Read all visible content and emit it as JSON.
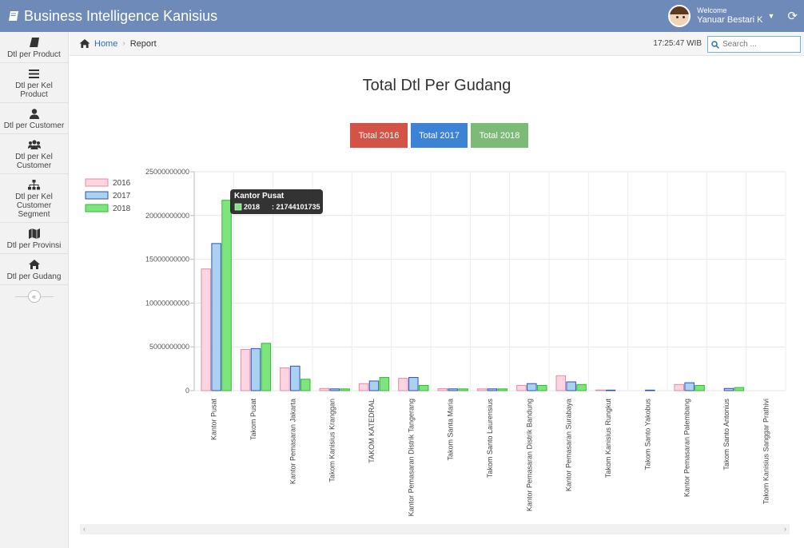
{
  "app": {
    "title": "Business Intelligence Kanisius"
  },
  "user": {
    "welcome": "Welcome",
    "name": "Yanuar Bestari K"
  },
  "sidebar": {
    "items": [
      {
        "label": "Dtl per Product",
        "icon": "book-icon"
      },
      {
        "label": "Dtl per Kel Product",
        "icon": "list-icon"
      },
      {
        "label": "Dtl per Customer",
        "icon": "user-icon"
      },
      {
        "label": "Dtl per Kel Customer",
        "icon": "users-icon"
      },
      {
        "label": "Dtl per Kel Customer Segment",
        "icon": "sitemap-icon"
      },
      {
        "label": "Dtl per Provinsi",
        "icon": "map-icon"
      },
      {
        "label": "Dtl per Gudang",
        "icon": "home-icon"
      }
    ],
    "collapse": "«"
  },
  "breadcrumb": {
    "home": "Home",
    "current": "Report"
  },
  "clock": "17:25:47 WIB",
  "search": {
    "placeholder": "Search ..."
  },
  "page": {
    "title": "Total Dtl Per Gudang",
    "buttons": [
      {
        "label": "Total 2016",
        "color": "#d35446"
      },
      {
        "label": "Total 2017",
        "color": "#3d83d5"
      },
      {
        "label": "Total 2018",
        "color": "#7cba78"
      }
    ]
  },
  "tooltip": {
    "title": "Kantor Pusat",
    "series": "2018",
    "value": ": 21744101735"
  },
  "chart_data": {
    "type": "bar",
    "title": "",
    "ylim": [
      0,
      25000000000
    ],
    "yticks": [
      0,
      5000000000,
      10000000000,
      15000000000,
      20000000000,
      25000000000
    ],
    "grid": true,
    "legend": "left",
    "categories": [
      "Kantor Pusat",
      "Takom Pusat",
      "Kantor Pemasaran Jakarta",
      "Takom Kanisius Kranggan",
      "TAKOM KATEDRAL",
      "Kantor Pemasaran Distrik Tangerang",
      "Takom Santa Maria",
      "Takom Santo Laurensius",
      "Kantor Pemasaran Distrik Bandung",
      "Kantor Pemasaran Surabaya",
      "Takom Kanisius Rungkut",
      "Takom Santo Yakobus",
      "Kantor Pemasaran Palembang",
      "Takom Santo Antonius",
      "Takom Kanisius Sanggar Prathivi"
    ],
    "series": [
      {
        "name": "2016",
        "fill": "#fcd5e0",
        "stroke": "#e58aa5",
        "values": [
          13900000000,
          4700000000,
          2600000000,
          250000000,
          800000000,
          1400000000,
          220000000,
          200000000,
          600000000,
          1700000000,
          70000000,
          0,
          700000000,
          0,
          0
        ]
      },
      {
        "name": "2017",
        "fill": "#a9d2f2",
        "stroke": "#2f4fb3",
        "values": [
          16800000000,
          4800000000,
          2800000000,
          200000000,
          1100000000,
          1500000000,
          200000000,
          200000000,
          800000000,
          1000000000,
          60000000,
          60000000,
          900000000,
          250000000,
          0
        ]
      },
      {
        "name": "2018",
        "fill": "#7ee57e",
        "stroke": "#2ebb2e",
        "values": [
          21744101735,
          5400000000,
          1300000000,
          200000000,
          1500000000,
          600000000,
          200000000,
          200000000,
          600000000,
          700000000,
          0,
          0,
          600000000,
          350000000,
          0
        ]
      }
    ]
  }
}
